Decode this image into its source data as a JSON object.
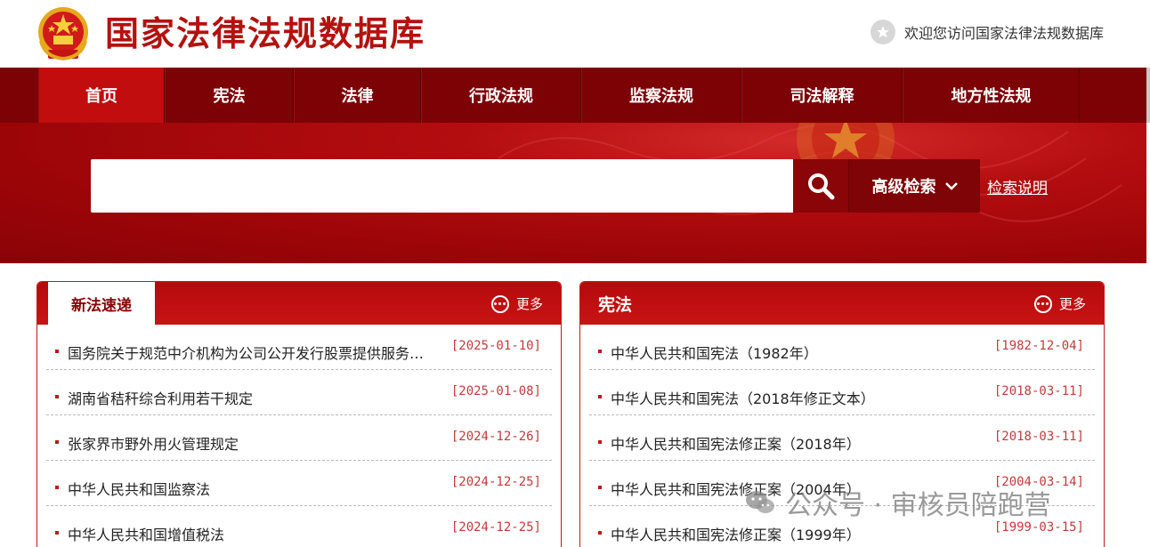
{
  "header": {
    "site_title": "国家法律法规数据库",
    "welcome_text": "欢迎您访问国家法律法规数据库"
  },
  "nav": {
    "items": [
      {
        "label": "首页",
        "active": true
      },
      {
        "label": "宪法"
      },
      {
        "label": "法律"
      },
      {
        "label": "行政法规"
      },
      {
        "label": "监察法规"
      },
      {
        "label": "司法解释"
      },
      {
        "label": "地方性法规"
      }
    ]
  },
  "search": {
    "value": "",
    "advanced_label": "高级检索",
    "help_label": "检索说明"
  },
  "panels": {
    "new_laws": {
      "title": "新法速递",
      "more_label": "更多",
      "items": [
        {
          "title": "国务院关于规范中介机构为公司公开发行股票提供服务…",
          "date": "[2025-01-10]"
        },
        {
          "title": "湖南省秸秆综合利用若干规定",
          "date": "[2025-01-08]"
        },
        {
          "title": "张家界市野外用火管理规定",
          "date": "[2024-12-26]"
        },
        {
          "title": "中华人民共和国监察法",
          "date": "[2024-12-25]"
        },
        {
          "title": "中华人民共和国增值税法",
          "date": "[2024-12-25]"
        }
      ]
    },
    "constitution": {
      "title": "宪法",
      "more_label": "更多",
      "items": [
        {
          "title": "中华人民共和国宪法（1982年）",
          "date": "[1982-12-04]"
        },
        {
          "title": "中华人民共和国宪法（2018年修正文本）",
          "date": "[2018-03-11]"
        },
        {
          "title": "中华人民共和国宪法修正案（2018年）",
          "date": "[2018-03-11]"
        },
        {
          "title": "中华人民共和国宪法修正案（2004年）",
          "date": "[2004-03-14]"
        },
        {
          "title": "中华人民共和国宪法修正案（1999年）",
          "date": "[1999-03-15]"
        }
      ]
    }
  },
  "watermark": {
    "text": "公众号 · 审核员陪跑营"
  },
  "colors": {
    "brand_red": "#b3120f",
    "nav_dark": "#7c0205",
    "nav_active": "#c10d0d",
    "date_red": "#c23b3b"
  }
}
